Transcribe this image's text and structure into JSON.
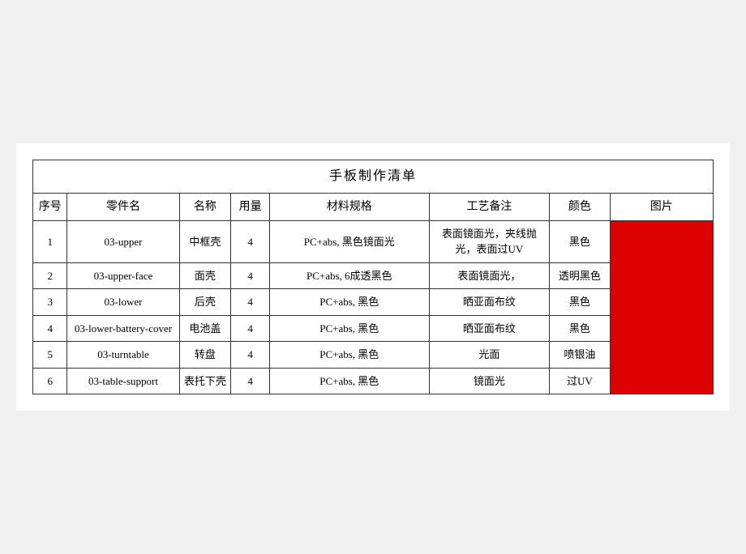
{
  "table": {
    "title": "手板制作清单",
    "headers": {
      "seq": "序号",
      "part": "零件名",
      "name": "名称",
      "qty": "用量",
      "spec": "材料规格",
      "process": "工艺备注",
      "color": "颜色",
      "image": "图片"
    },
    "rows": [
      {
        "seq": "1",
        "part": "03-upper",
        "name": "中框壳",
        "qty": "4",
        "spec": "PC+abs, 黑色镜面光",
        "process": "表面镜面光，夹线抛光，表面过UV",
        "color": "黑色"
      },
      {
        "seq": "2",
        "part": "03-upper-face",
        "name": "面壳",
        "qty": "4",
        "spec": "PC+abs, 6成透黑色",
        "process": "表面镜面光，",
        "color": "透明黑色"
      },
      {
        "seq": "3",
        "part": "03-lower",
        "name": "后壳",
        "qty": "4",
        "spec": "PC+abs, 黑色",
        "process": "晒亚面布纹",
        "color": "黑色"
      },
      {
        "seq": "4",
        "part": "03-lower-battery-cover",
        "name": "电池盖",
        "qty": "4",
        "spec": "PC+abs, 黑色",
        "process": "晒亚面布纹",
        "color": "黑色"
      },
      {
        "seq": "5",
        "part": "03-turntable",
        "name": "转盘",
        "qty": "4",
        "spec": "PC+abs, 黑色",
        "process": "光面",
        "color": "喷银油"
      },
      {
        "seq": "6",
        "part": "03-table-support",
        "name": "表托下壳",
        "qty": "4",
        "spec": "PC+abs, 黑色",
        "process": "镜面光",
        "color": "过UV"
      }
    ]
  }
}
